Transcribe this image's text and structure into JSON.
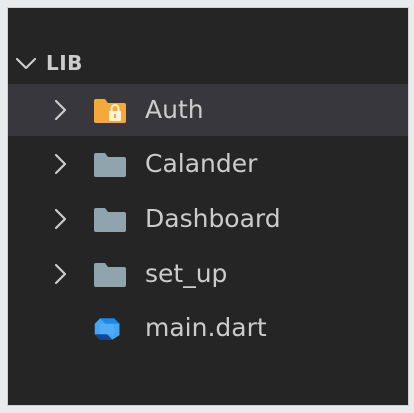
{
  "explorer": {
    "section_title": "LIB",
    "items": [
      {
        "label": "Auth",
        "kind": "folder-locked",
        "selected": true
      },
      {
        "label": "Calander",
        "kind": "folder"
      },
      {
        "label": "Dashboard",
        "kind": "folder"
      },
      {
        "label": "set_up",
        "kind": "folder"
      },
      {
        "label": "main.dart",
        "kind": "dart-file"
      }
    ]
  },
  "colors": {
    "background": "#252526",
    "selected_row": "#37373d",
    "text": "#cccccc",
    "folder": "#90a4ae",
    "folder_locked": "#f4a93b",
    "dart": "#42a5f5"
  }
}
